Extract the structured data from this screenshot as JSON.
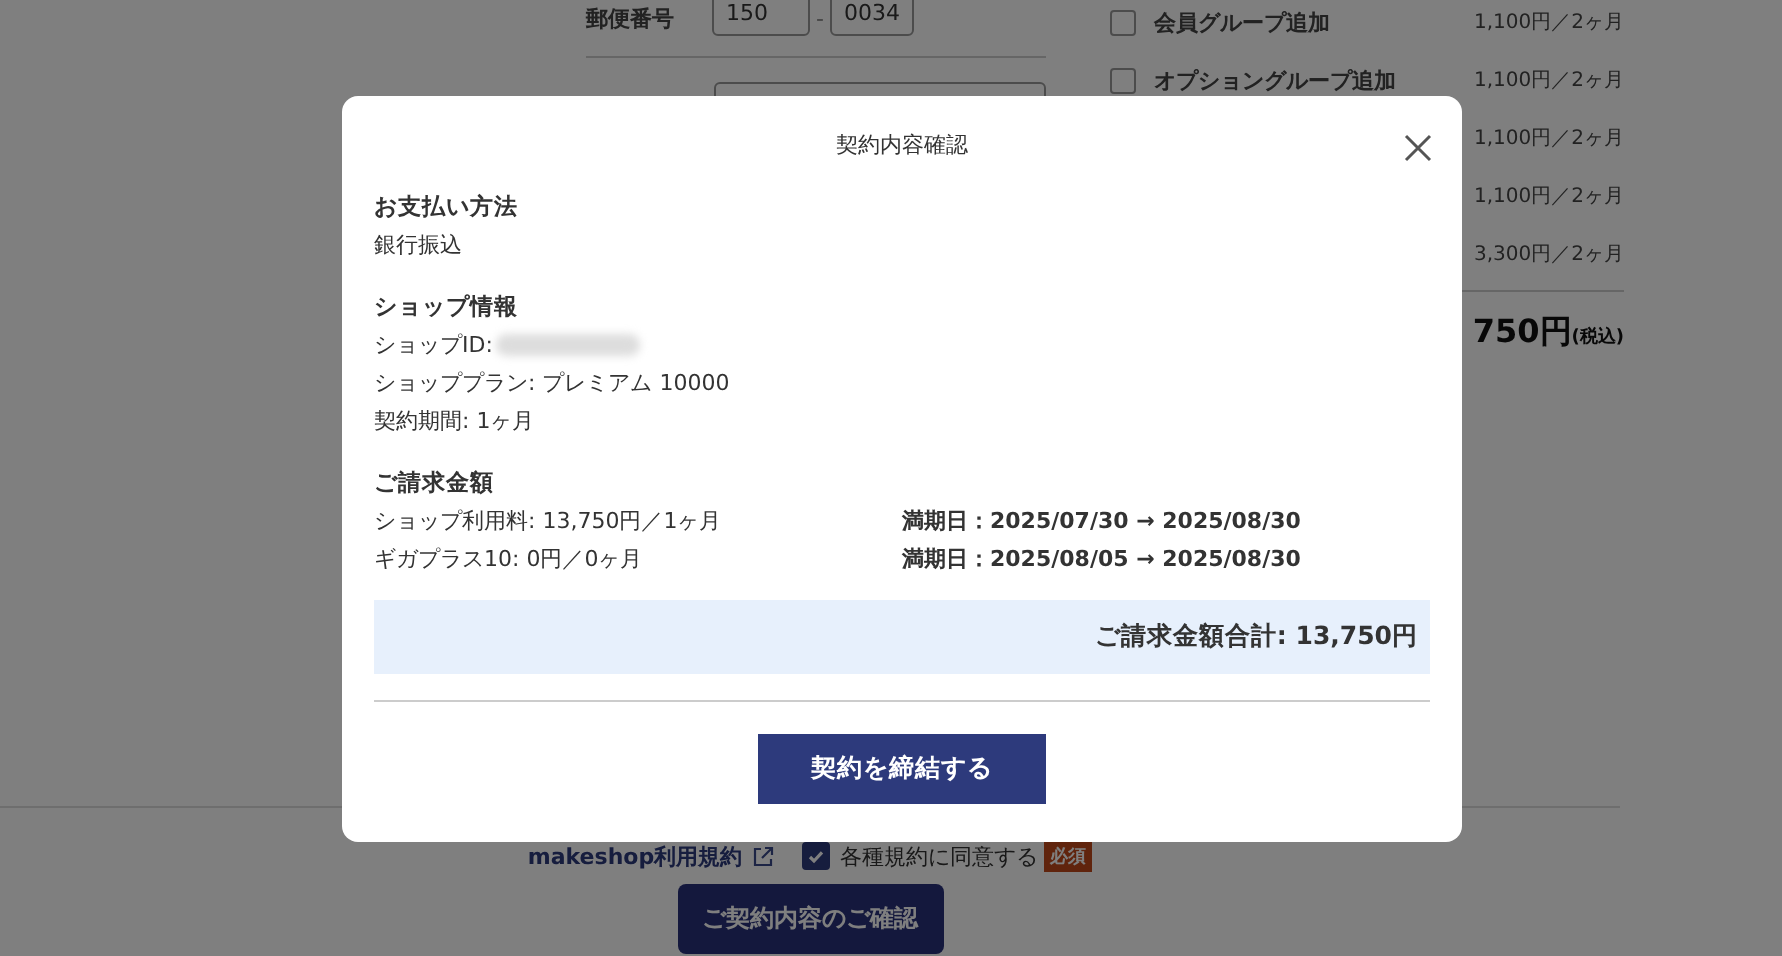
{
  "background_page": {
    "postal_code": {
      "label": "郵便番号",
      "first": "150",
      "separator": "-",
      "second": "0034"
    },
    "options": [
      {
        "label": "会員グループ追加",
        "price": "1,100円／2ヶ月",
        "checked": false
      },
      {
        "label": "オプショングループ追加",
        "price": "1,100円／2ヶ月",
        "checked": false
      },
      {
        "price": "1,100円／2ヶ月"
      },
      {
        "price": "1,100円／2ヶ月"
      },
      {
        "price": "3,300円／2ヶ月"
      }
    ],
    "total": {
      "amount": "750円",
      "tax_note": "(税込)"
    },
    "footer": {
      "terms_link": "makeshop利用規約",
      "agree": {
        "label": "各種規約に同意する",
        "checked": true
      },
      "required_badge": "必須",
      "confirm_button": "ご契約内容のご確認"
    }
  },
  "dialog": {
    "title": "契約内容確認",
    "sections": [
      {
        "heading": "お支払い方法",
        "lines": [
          {
            "text": "銀行振込"
          }
        ]
      },
      {
        "heading": "ショップ情報",
        "lines": [
          {
            "text": "ショップID:",
            "redacted": true
          },
          {
            "text": "ショッププラン: プレミアム 10000"
          },
          {
            "text": "契約期間: 1ヶ月"
          }
        ]
      }
    ],
    "billing": {
      "heading": "ご請求金額",
      "rows": [
        {
          "item": "ショップ利用料: 13,750円／1ヶ月",
          "period": "満期日：2025/07/30 → 2025/08/30"
        },
        {
          "item": "ギガプラス10: 0円／0ヶ月",
          "period": "満期日：2025/08/05 → 2025/08/30"
        }
      ],
      "total": "ご請求金額合計: 13,750円"
    },
    "submit_button": "契約を締結する"
  }
}
